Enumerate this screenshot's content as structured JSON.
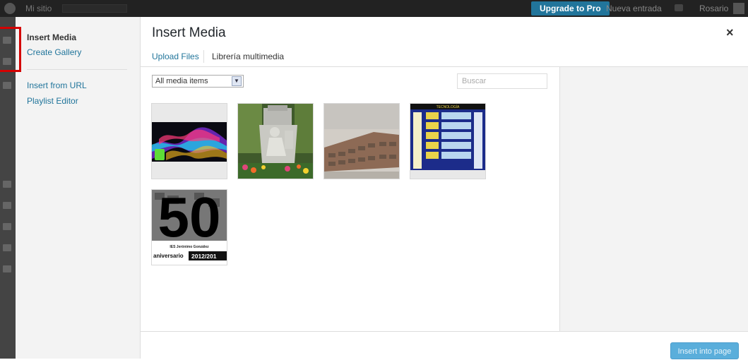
{
  "adminbar": {
    "site_name": "Mi sitio",
    "upgrade_label": "Upgrade to Pro",
    "new_entry_label": "Nueva entrada",
    "user_name": "Rosario"
  },
  "menu": {
    "items": [
      {
        "label": "Insert Media",
        "active": true
      },
      {
        "label": "Create Gallery",
        "active": false
      },
      {
        "label": "Insert from URL",
        "active": false
      },
      {
        "label": "Playlist Editor",
        "active": false
      }
    ]
  },
  "frame": {
    "title": "Insert Media",
    "close_glyph": "×"
  },
  "tabs": [
    {
      "label": "Upload Files"
    },
    {
      "label": "Librería multimedia"
    }
  ],
  "toolbar": {
    "filter_selected": "All media items",
    "search_placeholder": "Buscar"
  },
  "thumbnails": [
    {
      "name": "colorful-smoke-image"
    },
    {
      "name": "statue-monument-image"
    },
    {
      "name": "school-building-image"
    },
    {
      "name": "tecnologia-poster-image",
      "caption": "TECNOLOGÍA"
    },
    {
      "name": "anniversary-poster-image",
      "big_text": "50",
      "line1": "IES Jerónimo González",
      "line2": "aniversario",
      "line3": "2012/201"
    }
  ],
  "footer": {
    "insert_label": "Insert into page"
  },
  "colors": {
    "accent": "#21759b",
    "button_disabled": "#5aaedb",
    "highlight": "#d40000"
  }
}
